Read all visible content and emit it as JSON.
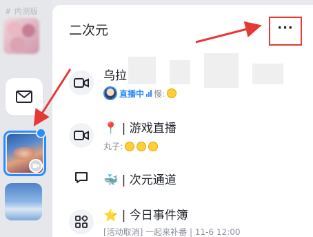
{
  "rail": {
    "watermark": "# 内测版"
  },
  "header": {
    "title": "二次元",
    "more_label": "···"
  },
  "channels": [
    {
      "name": "乌拉",
      "icon": "video-icon",
      "status_live": "直播中",
      "status_user": "慢:"
    },
    {
      "name": "| 游戏直播",
      "icon": "video-icon",
      "emoji": "📍",
      "sub": "丸子:"
    },
    {
      "name": "| 次元通道",
      "icon": "chat-bubble-icon",
      "emoji": "🐳",
      "selected": true
    },
    {
      "name": "| 今日事件簿",
      "icon": "grid-icon",
      "emoji": "⭐",
      "sub": "[活动取消] 一起来补番 | 11-6 12:00"
    }
  ],
  "colors": {
    "accent": "#2a8dff",
    "annotation": "#e53935"
  }
}
